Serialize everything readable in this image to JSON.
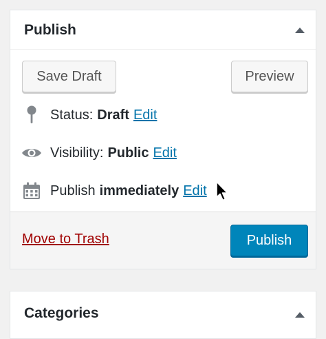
{
  "publish_box": {
    "title": "Publish",
    "save_draft_label": "Save Draft",
    "preview_label": "Preview",
    "status": {
      "label": "Status:",
      "value": "Draft",
      "edit_label": "Edit",
      "icon": "pin-icon"
    },
    "visibility": {
      "label": "Visibility:",
      "value": "Public",
      "edit_label": "Edit",
      "icon": "eye-icon"
    },
    "schedule": {
      "label": "Publish",
      "value": "immediately",
      "edit_label": "Edit",
      "icon": "calendar-icon"
    },
    "trash_label": "Move to Trash",
    "publish_label": "Publish"
  },
  "categories_box": {
    "title": "Categories"
  },
  "colors": {
    "link": "#0073aa",
    "trash": "#a00000",
    "primary_button": "#0085ba",
    "icon": "#82878c"
  }
}
